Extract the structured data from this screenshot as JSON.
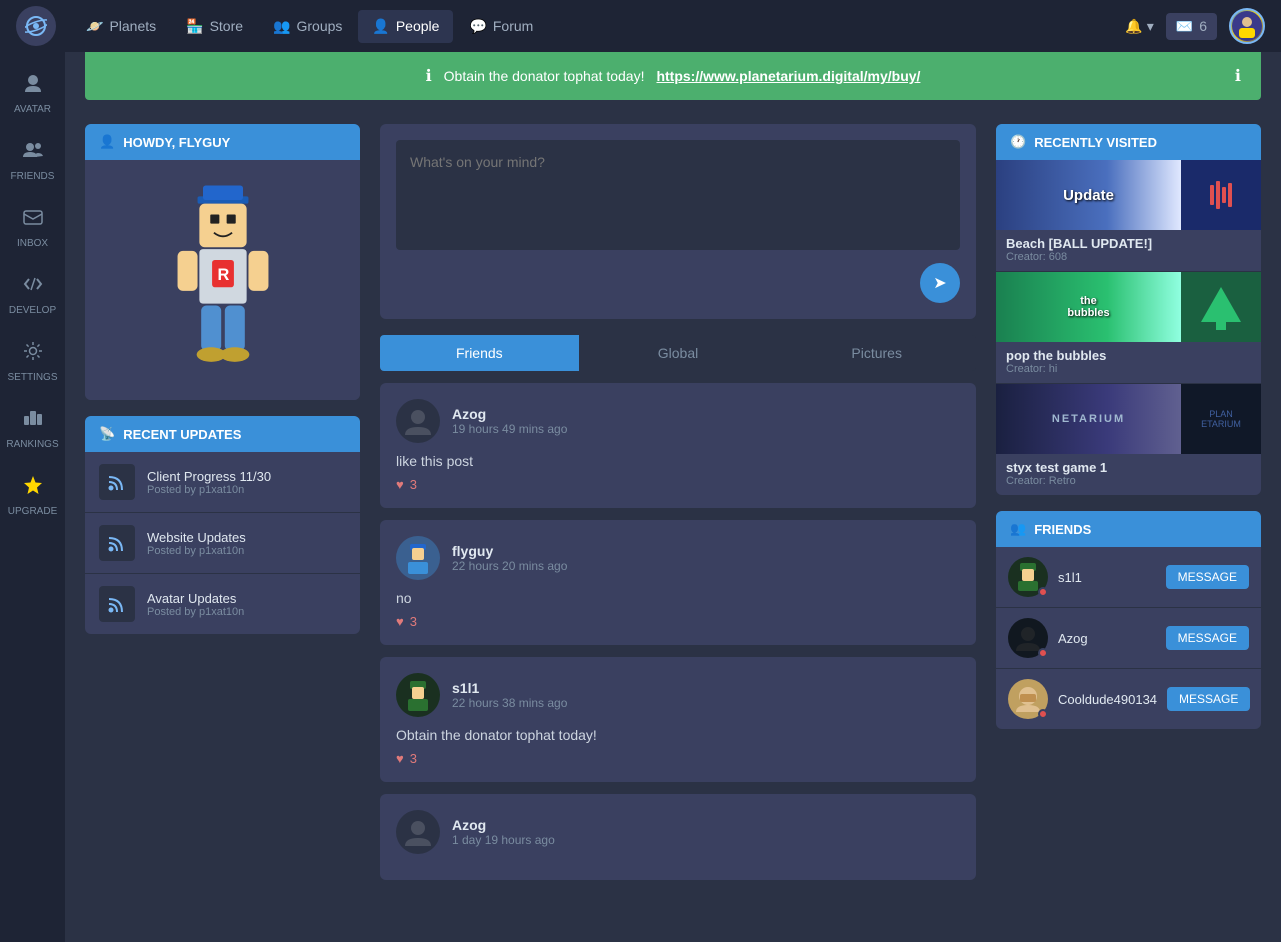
{
  "topnav": {
    "items": [
      {
        "label": "Planets",
        "icon": "planet-icon",
        "active": false
      },
      {
        "label": "Store",
        "icon": "store-icon",
        "active": false
      },
      {
        "label": "Groups",
        "icon": "groups-icon",
        "active": false
      },
      {
        "label": "People",
        "icon": "people-icon",
        "active": true
      },
      {
        "label": "Forum",
        "icon": "forum-icon",
        "active": false
      }
    ],
    "messages_count": "6",
    "bell_label": "🔔"
  },
  "sidebar": {
    "items": [
      {
        "label": "AVATAR",
        "icon": "avatar-icon"
      },
      {
        "label": "FRIENDS",
        "icon": "friends-icon"
      },
      {
        "label": "INBOX",
        "icon": "inbox-icon"
      },
      {
        "label": "DEVELOP",
        "icon": "develop-icon"
      },
      {
        "label": "SETTINGS",
        "icon": "settings-icon"
      },
      {
        "label": "RANKINGS",
        "icon": "rankings-icon"
      },
      {
        "label": "UPGRADE",
        "icon": "upgrade-icon"
      }
    ]
  },
  "banner": {
    "text": "Obtain the donator tophat today!",
    "link": "https://www.planetarium.digital/my/buy/",
    "icon": "ℹ"
  },
  "left": {
    "howdy_title": "HOWDY, FLYGUY",
    "updates_title": "RECENT UPDATES",
    "updates": [
      {
        "title": "Client Progress 11/30",
        "sub": "Posted by p1xat10n"
      },
      {
        "title": "Website Updates",
        "sub": "Posted by p1xat10n"
      },
      {
        "title": "Avatar Updates",
        "sub": "Posted by p1xat10n"
      }
    ]
  },
  "feed": {
    "placeholder": "What's on your mind?",
    "tabs": [
      {
        "label": "Friends",
        "active": true
      },
      {
        "label": "Global",
        "active": false
      },
      {
        "label": "Pictures",
        "active": false
      }
    ],
    "posts": [
      {
        "username": "Azog",
        "time": "19 hours 49 mins ago",
        "body": "like this post",
        "likes": 3,
        "avatar_color": "#2b3245"
      },
      {
        "username": "flyguy",
        "time": "22 hours 20 mins ago",
        "body": "no",
        "likes": 3,
        "avatar_color": "#3a90d9"
      },
      {
        "username": "s1l1",
        "time": "22 hours 38 mins ago",
        "body": "Obtain the donator tophat today!",
        "likes": 3,
        "avatar_color": "#2a6030"
      },
      {
        "username": "Azog",
        "time": "1 day 19 hours ago",
        "body": "",
        "likes": 0,
        "avatar_color": "#2b3245"
      }
    ]
  },
  "right": {
    "recently_title": "RECENTLY VISITED",
    "recently": [
      {
        "title": "Beach [BALL UPDATE!]",
        "creator": "Creator: 608",
        "bg": "beach"
      },
      {
        "title": "pop the bubbles",
        "creator": "Creator: hi",
        "bg": "bubbles"
      },
      {
        "title": "styx test game 1",
        "creator": "Creator: Retro",
        "bg": "styx"
      }
    ],
    "friends_title": "FRIENDS",
    "friends": [
      {
        "name": "s1l1",
        "online": true
      },
      {
        "name": "Azog",
        "online": true
      },
      {
        "name": "Cooldude490134",
        "online": true
      }
    ],
    "message_btn": "MESSAGE"
  }
}
